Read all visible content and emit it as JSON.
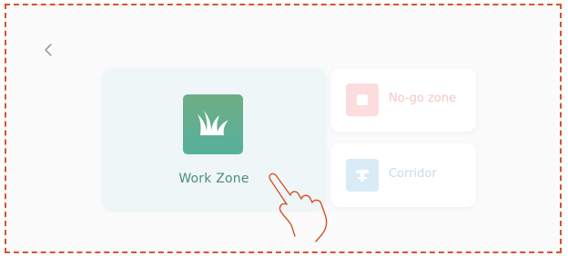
{
  "header": {
    "back_icon": "chevron-left-icon"
  },
  "zones": {
    "work": {
      "label": "Work Zone",
      "icon": "grass-icon",
      "color": "#5cae8f",
      "selected": true
    },
    "nogo": {
      "label": "No-go zone",
      "icon": "square-icon",
      "color": "#f4c7c9"
    },
    "corridor": {
      "label": "Corridor",
      "icon": "corridor-icon",
      "color": "#c5dceb"
    }
  },
  "overlay": {
    "icon": "tap-hand-icon",
    "border_color": "#d5542e"
  }
}
